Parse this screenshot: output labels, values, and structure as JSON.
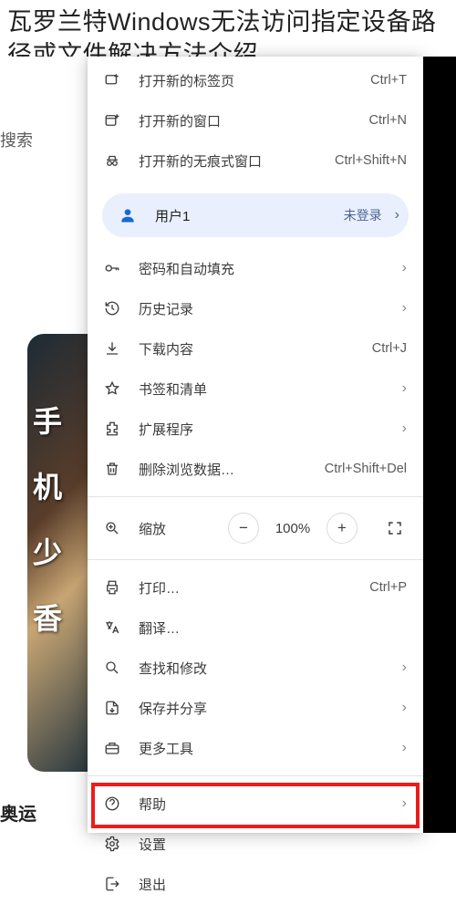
{
  "article": {
    "title": "瓦罗兰特Windows无法访问指定设备路径或文件解决方法介绍"
  },
  "sidebar": {
    "search_text": "搜索",
    "bottom_text": "奥运",
    "thumb_letters": "手\n机\n少\n香"
  },
  "menu": {
    "new_tab": {
      "label": "打开新的标签页",
      "hotkey": "Ctrl+T"
    },
    "new_window": {
      "label": "打开新的窗口",
      "hotkey": "Ctrl+N"
    },
    "incognito": {
      "label": "打开新的无痕式窗口",
      "hotkey": "Ctrl+Shift+N"
    },
    "profile": {
      "label": "用户1",
      "status": "未登录"
    },
    "passwords": {
      "label": "密码和自动填充"
    },
    "history": {
      "label": "历史记录"
    },
    "downloads": {
      "label": "下载内容",
      "hotkey": "Ctrl+J"
    },
    "bookmarks": {
      "label": "书签和清单"
    },
    "extensions": {
      "label": "扩展程序"
    },
    "clear_data": {
      "label": "删除浏览数据…",
      "hotkey": "Ctrl+Shift+Del"
    },
    "zoom": {
      "label": "缩放",
      "value": "100%"
    },
    "print": {
      "label": "打印…",
      "hotkey": "Ctrl+P"
    },
    "translate": {
      "label": "翻译…"
    },
    "find_edit": {
      "label": "查找和修改"
    },
    "save_share": {
      "label": "保存并分享"
    },
    "more_tools": {
      "label": "更多工具"
    },
    "help": {
      "label": "帮助"
    },
    "settings": {
      "label": "设置"
    },
    "exit": {
      "label": "退出"
    }
  }
}
